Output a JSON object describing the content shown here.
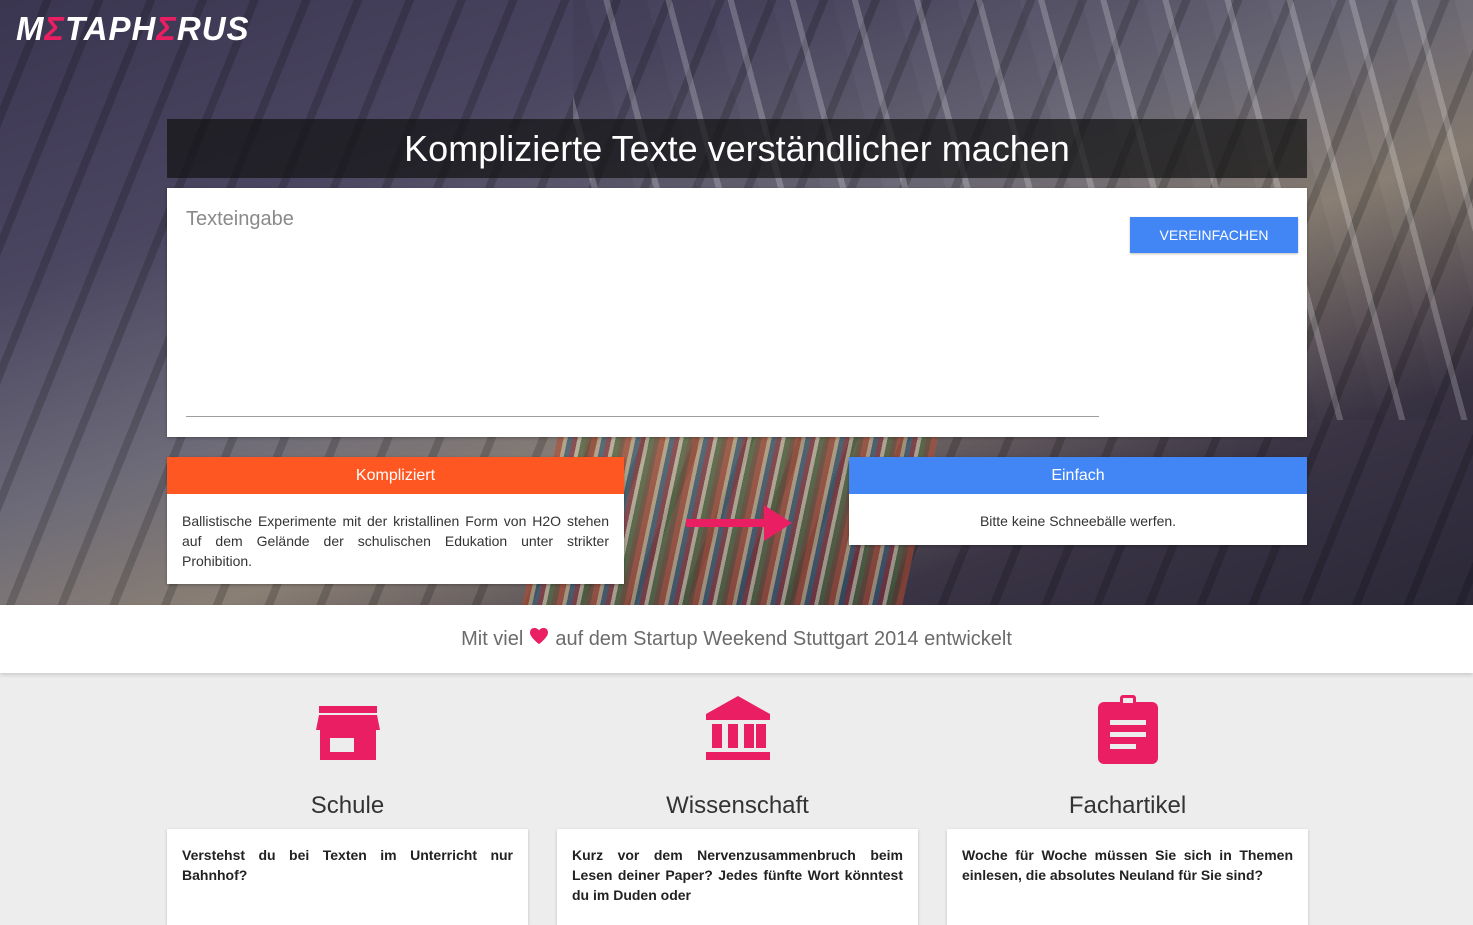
{
  "logo": {
    "part1": "M",
    "e1": "Σ",
    "part2": "TAPH",
    "e2": "Σ",
    "part3": "RUS"
  },
  "hero": {
    "title": "Komplizierte Texte verständlicher machen"
  },
  "input": {
    "placeholder": "Texteingabe",
    "value": ""
  },
  "simplify_button": {
    "label": "VEREINFACHEN"
  },
  "complex_card": {
    "header": "Kompliziert",
    "text": "Ballistische Experimente mit der kristallinen Form von H2O stehen auf dem Gelände der schulischen Edukation unter strikter Prohibition."
  },
  "simple_card": {
    "header": "Einfach",
    "text": "Bitte keine Schneebälle werfen."
  },
  "credit": {
    "before": "Mit viel",
    "after": "auf dem Startup Weekend Stuttgart 2014 entwickelt"
  },
  "features": [
    {
      "icon": "store-icon",
      "title": "Schule",
      "text": "Verstehst du bei Texten im Unterricht nur Bahnhof?"
    },
    {
      "icon": "institution-icon",
      "title": "Wissenschaft",
      "text": "Kurz vor dem Nervenzusammenbruch beim Lesen deiner Paper? Jedes fünfte Wort könntest du im Duden oder"
    },
    {
      "icon": "clipboard-icon",
      "title": "Fachartikel",
      "text": "Woche für Woche müssen Sie sich in Themen einlesen, die absolutes Neuland für Sie sind?"
    }
  ],
  "colors": {
    "accent": "#e91e63",
    "primary": "#4285f4",
    "complex": "#ff5722"
  }
}
